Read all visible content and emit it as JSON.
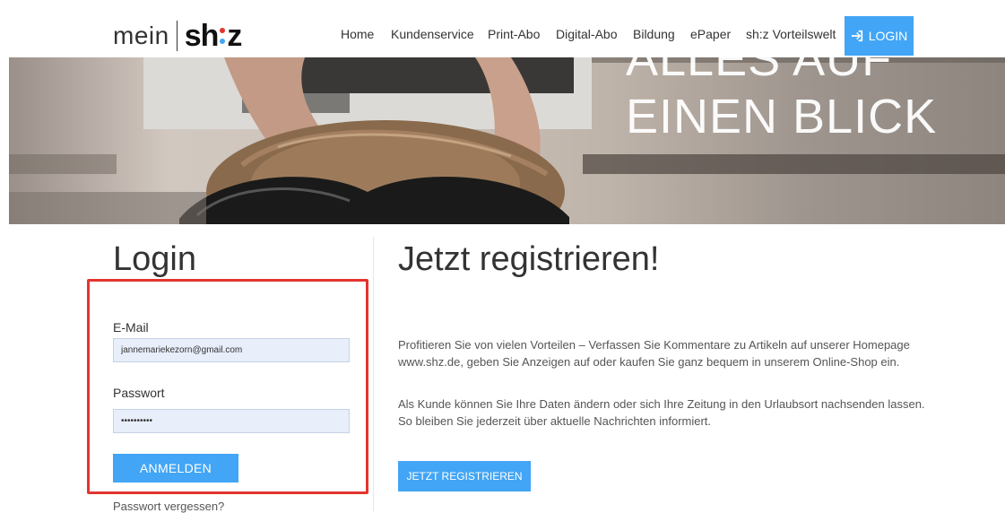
{
  "header": {
    "logo_prefix": "mein",
    "logo_brand_left": "sh",
    "logo_brand_right": "z",
    "nav": [
      {
        "label": "Home"
      },
      {
        "label": "Kundenservice"
      },
      {
        "label": "Print-Abo"
      },
      {
        "label": "Digital-Abo"
      },
      {
        "label": "Bildung"
      },
      {
        "label": "ePaper"
      },
      {
        "label": "sh:z Vorteilswelt"
      }
    ],
    "login_label": "LOGIN",
    "accent_color": "#42a5f5",
    "logo_dot_colors": [
      "#e3342f",
      "#42a5f5"
    ]
  },
  "hero": {
    "line1": "ALLES AUF",
    "line2": "EINEN BLICK"
  },
  "login": {
    "heading": "Login",
    "email_label": "E-Mail",
    "email_value": "jannemariekezorn@gmail.com",
    "password_label": "Passwort",
    "password_value": "••••••••••",
    "submit_label": "ANMELDEN",
    "forgot_label": "Passwort vergessen?",
    "highlight_color": "#e3342f"
  },
  "register": {
    "heading": "Jetzt registrieren!",
    "paragraph1": "Profitieren Sie von vielen Vorteilen – Verfassen Sie Kommentare zu Artikeln auf unserer Homepage www.shz.de, geben Sie Anzeigen auf oder kaufen Sie ganz bequem in unserem Online-Shop ein.",
    "paragraph2": "Als Kunde können Sie Ihre Daten ändern oder sich Ihre Zeitung in den Urlaubsort nachsenden lassen. So bleiben Sie jederzeit über aktuelle Nachrichten informiert.",
    "button_label": "JETZT REGISTRIEREN"
  }
}
